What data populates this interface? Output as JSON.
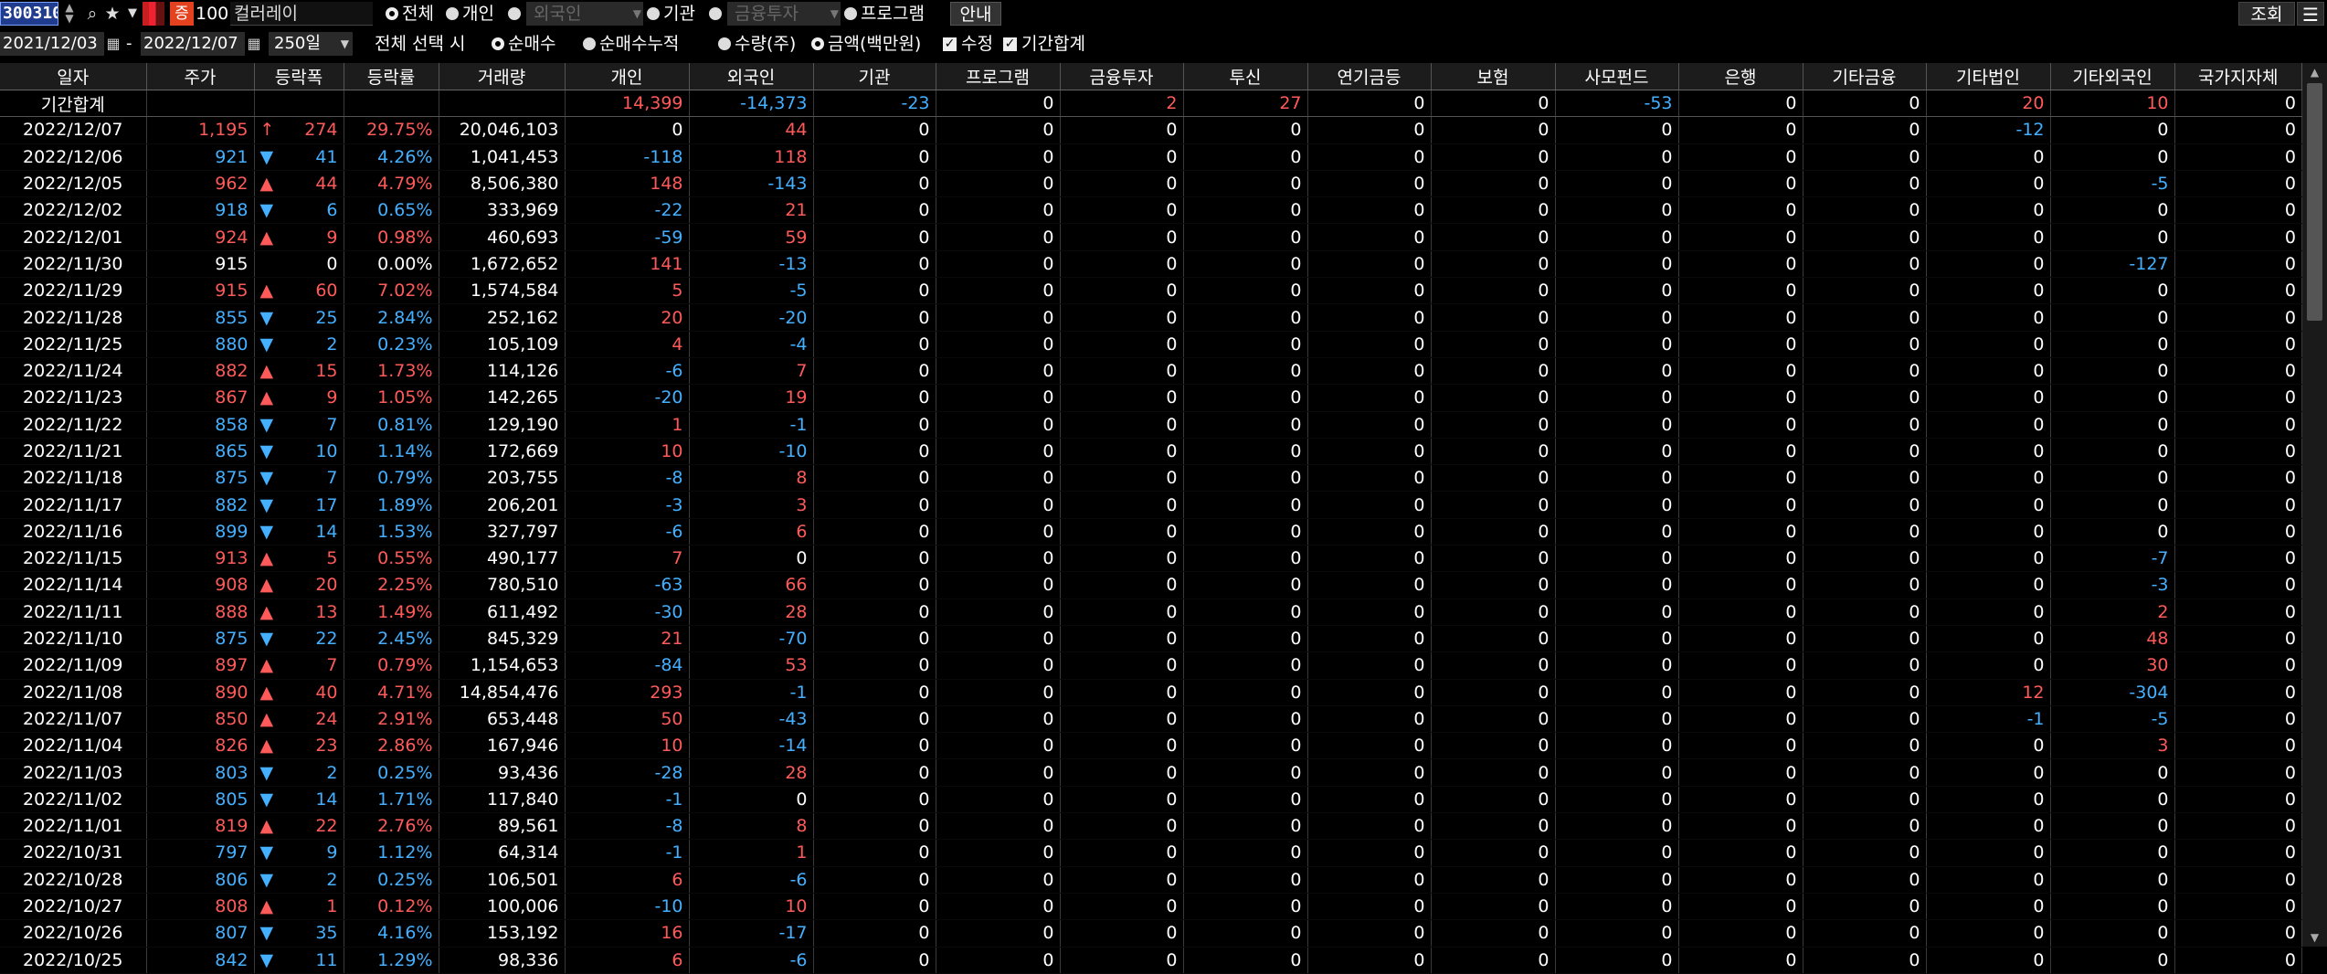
{
  "toolbar": {
    "stock_code": "300310",
    "margin_badge": "증",
    "margin_rate": "100",
    "stock_name": "컬러레이",
    "investor_radios": [
      "전체",
      "개인",
      "외국인",
      "기관",
      "금융투자",
      "프로그램"
    ],
    "selected_radio": "전체",
    "guide_button": "안내",
    "query_button": "조회",
    "menu_icon": "☰"
  },
  "filters": {
    "start_date": "2021/12/03",
    "end_date": "2022/12/07",
    "date_separator": "-",
    "count": "250일",
    "select_all_label": "전체 선택 시",
    "mode_radios": [
      "순매수",
      "순매수누적"
    ],
    "unit_radios": [
      "수량(주)",
      "금액(백만원)"
    ],
    "checkboxes": [
      "수정",
      "기간합계"
    ]
  },
  "table": {
    "headers": [
      "일자",
      "주가",
      "등락폭",
      "등락률",
      "거래량",
      "개인",
      "외국인",
      "기관",
      "프로그램",
      "금융투자",
      "투신",
      "연기금등",
      "보험",
      "사모펀드",
      "은행",
      "기타금융",
      "기타법인",
      "기타외국인",
      "국가지자체"
    ],
    "summary": {
      "label": "기간합계",
      "values": [
        "",
        "",
        "",
        "",
        "14,399",
        "-14,373",
        "-23",
        "0",
        "2",
        "27",
        "0",
        "0",
        "-53",
        "0",
        "0",
        "20",
        "10",
        "0"
      ]
    },
    "rows": [
      {
        "date": "2022/12/07",
        "price": "1,195",
        "dir": "↑",
        "chg": "274",
        "rate": "29.75%",
        "vol": "20,046,103",
        "flows": [
          "0",
          "44",
          "0",
          "0",
          "0",
          "0",
          "0",
          "0",
          "0",
          "0",
          "0",
          "-12",
          "0",
          "0"
        ]
      },
      {
        "date": "2022/12/06",
        "price": "921",
        "dir": "▼",
        "chg": "41",
        "rate": "4.26%",
        "vol": "1,041,453",
        "flows": [
          "-118",
          "118",
          "0",
          "0",
          "0",
          "0",
          "0",
          "0",
          "0",
          "0",
          "0",
          "0",
          "0",
          "0"
        ]
      },
      {
        "date": "2022/12/05",
        "price": "962",
        "dir": "▲",
        "chg": "44",
        "rate": "4.79%",
        "vol": "8,506,380",
        "flows": [
          "148",
          "-143",
          "0",
          "0",
          "0",
          "0",
          "0",
          "0",
          "0",
          "0",
          "0",
          "0",
          "-5",
          "0"
        ]
      },
      {
        "date": "2022/12/02",
        "price": "918",
        "dir": "▼",
        "chg": "6",
        "rate": "0.65%",
        "vol": "333,969",
        "flows": [
          "-22",
          "21",
          "0",
          "0",
          "0",
          "0",
          "0",
          "0",
          "0",
          "0",
          "0",
          "0",
          "0",
          "0"
        ]
      },
      {
        "date": "2022/12/01",
        "price": "924",
        "dir": "▲",
        "chg": "9",
        "rate": "0.98%",
        "vol": "460,693",
        "flows": [
          "-59",
          "59",
          "0",
          "0",
          "0",
          "0",
          "0",
          "0",
          "0",
          "0",
          "0",
          "0",
          "0",
          "0"
        ]
      },
      {
        "date": "2022/11/30",
        "price": "915",
        "dir": "",
        "chg": "0",
        "rate": "0.00%",
        "vol": "1,672,652",
        "flows": [
          "141",
          "-13",
          "0",
          "0",
          "0",
          "0",
          "0",
          "0",
          "0",
          "0",
          "0",
          "0",
          "-127",
          "0"
        ]
      },
      {
        "date": "2022/11/29",
        "price": "915",
        "dir": "▲",
        "chg": "60",
        "rate": "7.02%",
        "vol": "1,574,584",
        "flows": [
          "5",
          "-5",
          "0",
          "0",
          "0",
          "0",
          "0",
          "0",
          "0",
          "0",
          "0",
          "0",
          "0",
          "0"
        ]
      },
      {
        "date": "2022/11/28",
        "price": "855",
        "dir": "▼",
        "chg": "25",
        "rate": "2.84%",
        "vol": "252,162",
        "flows": [
          "20",
          "-20",
          "0",
          "0",
          "0",
          "0",
          "0",
          "0",
          "0",
          "0",
          "0",
          "0",
          "0",
          "0"
        ]
      },
      {
        "date": "2022/11/25",
        "price": "880",
        "dir": "▼",
        "chg": "2",
        "rate": "0.23%",
        "vol": "105,109",
        "flows": [
          "4",
          "-4",
          "0",
          "0",
          "0",
          "0",
          "0",
          "0",
          "0",
          "0",
          "0",
          "0",
          "0",
          "0"
        ]
      },
      {
        "date": "2022/11/24",
        "price": "882",
        "dir": "▲",
        "chg": "15",
        "rate": "1.73%",
        "vol": "114,126",
        "flows": [
          "-6",
          "7",
          "0",
          "0",
          "0",
          "0",
          "0",
          "0",
          "0",
          "0",
          "0",
          "0",
          "0",
          "0"
        ]
      },
      {
        "date": "2022/11/23",
        "price": "867",
        "dir": "▲",
        "chg": "9",
        "rate": "1.05%",
        "vol": "142,265",
        "flows": [
          "-20",
          "19",
          "0",
          "0",
          "0",
          "0",
          "0",
          "0",
          "0",
          "0",
          "0",
          "0",
          "0",
          "0"
        ]
      },
      {
        "date": "2022/11/22",
        "price": "858",
        "dir": "▼",
        "chg": "7",
        "rate": "0.81%",
        "vol": "129,190",
        "flows": [
          "1",
          "-1",
          "0",
          "0",
          "0",
          "0",
          "0",
          "0",
          "0",
          "0",
          "0",
          "0",
          "0",
          "0"
        ]
      },
      {
        "date": "2022/11/21",
        "price": "865",
        "dir": "▼",
        "chg": "10",
        "rate": "1.14%",
        "vol": "172,669",
        "flows": [
          "10",
          "-10",
          "0",
          "0",
          "0",
          "0",
          "0",
          "0",
          "0",
          "0",
          "0",
          "0",
          "0",
          "0"
        ]
      },
      {
        "date": "2022/11/18",
        "price": "875",
        "dir": "▼",
        "chg": "7",
        "rate": "0.79%",
        "vol": "203,755",
        "flows": [
          "-8",
          "8",
          "0",
          "0",
          "0",
          "0",
          "0",
          "0",
          "0",
          "0",
          "0",
          "0",
          "0",
          "0"
        ]
      },
      {
        "date": "2022/11/17",
        "price": "882",
        "dir": "▼",
        "chg": "17",
        "rate": "1.89%",
        "vol": "206,201",
        "flows": [
          "-3",
          "3",
          "0",
          "0",
          "0",
          "0",
          "0",
          "0",
          "0",
          "0",
          "0",
          "0",
          "0",
          "0"
        ]
      },
      {
        "date": "2022/11/16",
        "price": "899",
        "dir": "▼",
        "chg": "14",
        "rate": "1.53%",
        "vol": "327,797",
        "flows": [
          "-6",
          "6",
          "0",
          "0",
          "0",
          "0",
          "0",
          "0",
          "0",
          "0",
          "0",
          "0",
          "0",
          "0"
        ]
      },
      {
        "date": "2022/11/15",
        "price": "913",
        "dir": "▲",
        "chg": "5",
        "rate": "0.55%",
        "vol": "490,177",
        "flows": [
          "7",
          "0",
          "0",
          "0",
          "0",
          "0",
          "0",
          "0",
          "0",
          "0",
          "0",
          "0",
          "-7",
          "0"
        ]
      },
      {
        "date": "2022/11/14",
        "price": "908",
        "dir": "▲",
        "chg": "20",
        "rate": "2.25%",
        "vol": "780,510",
        "flows": [
          "-63",
          "66",
          "0",
          "0",
          "0",
          "0",
          "0",
          "0",
          "0",
          "0",
          "0",
          "0",
          "-3",
          "0"
        ]
      },
      {
        "date": "2022/11/11",
        "price": "888",
        "dir": "▲",
        "chg": "13",
        "rate": "1.49%",
        "vol": "611,492",
        "flows": [
          "-30",
          "28",
          "0",
          "0",
          "0",
          "0",
          "0",
          "0",
          "0",
          "0",
          "0",
          "0",
          "2",
          "0"
        ]
      },
      {
        "date": "2022/11/10",
        "price": "875",
        "dir": "▼",
        "chg": "22",
        "rate": "2.45%",
        "vol": "845,329",
        "flows": [
          "21",
          "-70",
          "0",
          "0",
          "0",
          "0",
          "0",
          "0",
          "0",
          "0",
          "0",
          "0",
          "48",
          "0"
        ]
      },
      {
        "date": "2022/11/09",
        "price": "897",
        "dir": "▲",
        "chg": "7",
        "rate": "0.79%",
        "vol": "1,154,653",
        "flows": [
          "-84",
          "53",
          "0",
          "0",
          "0",
          "0",
          "0",
          "0",
          "0",
          "0",
          "0",
          "0",
          "30",
          "0"
        ]
      },
      {
        "date": "2022/11/08",
        "price": "890",
        "dir": "▲",
        "chg": "40",
        "rate": "4.71%",
        "vol": "14,854,476",
        "flows": [
          "293",
          "-1",
          "0",
          "0",
          "0",
          "0",
          "0",
          "0",
          "0",
          "0",
          "0",
          "12",
          "-304",
          "0"
        ]
      },
      {
        "date": "2022/11/07",
        "price": "850",
        "dir": "▲",
        "chg": "24",
        "rate": "2.91%",
        "vol": "653,448",
        "flows": [
          "50",
          "-43",
          "0",
          "0",
          "0",
          "0",
          "0",
          "0",
          "0",
          "0",
          "0",
          "-1",
          "-5",
          "0"
        ]
      },
      {
        "date": "2022/11/04",
        "price": "826",
        "dir": "▲",
        "chg": "23",
        "rate": "2.86%",
        "vol": "167,946",
        "flows": [
          "10",
          "-14",
          "0",
          "0",
          "0",
          "0",
          "0",
          "0",
          "0",
          "0",
          "0",
          "0",
          "3",
          "0"
        ]
      },
      {
        "date": "2022/11/03",
        "price": "803",
        "dir": "▼",
        "chg": "2",
        "rate": "0.25%",
        "vol": "93,436",
        "flows": [
          "-28",
          "28",
          "0",
          "0",
          "0",
          "0",
          "0",
          "0",
          "0",
          "0",
          "0",
          "0",
          "0",
          "0"
        ]
      },
      {
        "date": "2022/11/02",
        "price": "805",
        "dir": "▼",
        "chg": "14",
        "rate": "1.71%",
        "vol": "117,840",
        "flows": [
          "-1",
          "0",
          "0",
          "0",
          "0",
          "0",
          "0",
          "0",
          "0",
          "0",
          "0",
          "0",
          "0",
          "0"
        ]
      },
      {
        "date": "2022/11/01",
        "price": "819",
        "dir": "▲",
        "chg": "22",
        "rate": "2.76%",
        "vol": "89,561",
        "flows": [
          "-8",
          "8",
          "0",
          "0",
          "0",
          "0",
          "0",
          "0",
          "0",
          "0",
          "0",
          "0",
          "0",
          "0"
        ]
      },
      {
        "date": "2022/10/31",
        "price": "797",
        "dir": "▼",
        "chg": "9",
        "rate": "1.12%",
        "vol": "64,314",
        "flows": [
          "-1",
          "1",
          "0",
          "0",
          "0",
          "0",
          "0",
          "0",
          "0",
          "0",
          "0",
          "0",
          "0",
          "0"
        ]
      },
      {
        "date": "2022/10/28",
        "price": "806",
        "dir": "▼",
        "chg": "2",
        "rate": "0.25%",
        "vol": "106,501",
        "flows": [
          "6",
          "-6",
          "0",
          "0",
          "0",
          "0",
          "0",
          "0",
          "0",
          "0",
          "0",
          "0",
          "0",
          "0"
        ]
      },
      {
        "date": "2022/10/27",
        "price": "808",
        "dir": "▲",
        "chg": "1",
        "rate": "0.12%",
        "vol": "100,006",
        "flows": [
          "-10",
          "10",
          "0",
          "0",
          "0",
          "0",
          "0",
          "0",
          "0",
          "0",
          "0",
          "0",
          "0",
          "0"
        ]
      },
      {
        "date": "2022/10/26",
        "price": "807",
        "dir": "▼",
        "chg": "35",
        "rate": "4.16%",
        "vol": "153,192",
        "flows": [
          "16",
          "-17",
          "0",
          "0",
          "0",
          "0",
          "0",
          "0",
          "0",
          "0",
          "0",
          "0",
          "0",
          "0"
        ]
      },
      {
        "date": "2022/10/25",
        "price": "842",
        "dir": "▼",
        "chg": "11",
        "rate": "1.29%",
        "vol": "98,336",
        "flows": [
          "6",
          "-6",
          "0",
          "0",
          "0",
          "0",
          "0",
          "0",
          "0",
          "0",
          "0",
          "0",
          "0",
          "0"
        ]
      }
    ]
  },
  "colors": {
    "up": "#ff5a5a",
    "down": "#44b0ff",
    "neutral": "#ffffff",
    "background": "#000000",
    "code_bg": "#1f3c8f",
    "badge": "#e4411f"
  }
}
